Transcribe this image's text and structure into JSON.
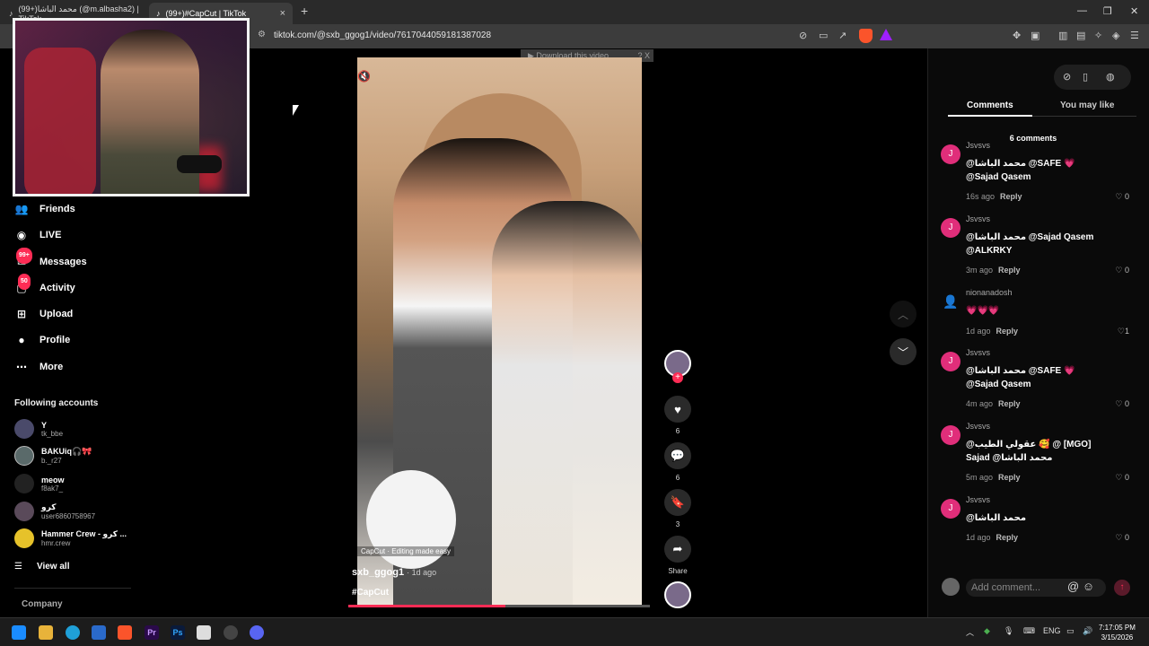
{
  "browser": {
    "tabs": [
      {
        "label": "(99+)محمد الباشا (@m.albasha2) | TikTok",
        "active": false
      },
      {
        "label": "(99+)#CapCut | TikTok",
        "active": true
      }
    ],
    "new_tab": "+",
    "url": "tiktok.com/@sxb_ggog1/video/7617044059181387028"
  },
  "download_bar": {
    "label": "Download this video",
    "help": "?",
    "close": "X"
  },
  "sidebar": {
    "nav": [
      {
        "label": "Friends",
        "icon": "friends-icon"
      },
      {
        "label": "LIVE",
        "icon": "live-icon"
      },
      {
        "label": "Messages",
        "icon": "messages-icon",
        "badge": "99+"
      },
      {
        "label": "Activity",
        "icon": "activity-icon",
        "badge": "50"
      },
      {
        "label": "Upload",
        "icon": "upload-icon"
      },
      {
        "label": "Profile",
        "icon": "profile-icon"
      },
      {
        "label": "More",
        "icon": "more-icon"
      }
    ],
    "following_title": "Following accounts",
    "following": [
      {
        "name": "Y",
        "handle": "tk_bbe"
      },
      {
        "name": "BAKUiq🎧🎀",
        "handle": "b._r27"
      },
      {
        "name": "meow",
        "handle": "f8ak7_"
      },
      {
        "name": "كرو",
        "handle": "user6860758967"
      },
      {
        "name": "Hammer Crew - كرو ...",
        "handle": "hmr.crew"
      }
    ],
    "view_all": "View all",
    "company": "Company"
  },
  "video": {
    "capcut_tag": "CapCut · Editing made easy",
    "author": "sxb_ggog1",
    "ago": "· 1d ago",
    "hashtag": "#CapCut",
    "progress_fraction": 0.52,
    "likes": "6",
    "comments": "6",
    "saves": "3",
    "share_label": "Share"
  },
  "comments_panel": {
    "tab_comments": "Comments",
    "tab_you_may_like": "You may like",
    "count_label": "6 comments",
    "comments": [
      {
        "user": "Jsvsvs",
        "avatar": "J",
        "text": "@محمد الباشا @SAFE 💗 @Sajad Qasem",
        "time": "16s ago",
        "likes": "0"
      },
      {
        "user": "Jsvsvs",
        "avatar": "J",
        "text": "@محمد الباشا @Sajad Qasem @ALKRKY",
        "time": "3m ago",
        "likes": "0"
      },
      {
        "user": "nionanadosh",
        "avatar": "",
        "text": "💗💗💗",
        "time": "1d ago",
        "likes": "1"
      },
      {
        "user": "Jsvsvs",
        "avatar": "J",
        "text": "@محمد الباشا @SAFE 💗 @Sajad Qasem",
        "time": "4m ago",
        "likes": "0"
      },
      {
        "user": "Jsvsvs",
        "avatar": "J",
        "text": "@عقولي الطيب 🥰 @ [MGO] Sajad @محمد الباشا",
        "time": "5m ago",
        "likes": "0"
      },
      {
        "user": "Jsvsvs",
        "avatar": "J",
        "text": "@محمد الباشا",
        "time": "1d ago",
        "likes": "0"
      }
    ],
    "reply_label": "Reply",
    "add_comment_placeholder": "Add comment..."
  },
  "taskbar": {
    "lang": "ENG",
    "time": "7:17:05 PM",
    "date": "3/15/2026"
  },
  "colors": {
    "accent": "#fe2c55",
    "comment_avatar": "#e02e7a"
  }
}
